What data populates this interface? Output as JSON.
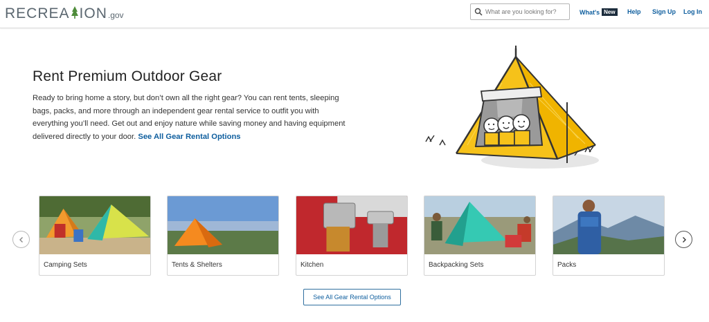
{
  "header": {
    "logo_main": "RECREATION",
    "logo_suffix": ".gov",
    "search_placeholder": "What are you looking for?",
    "nav": {
      "whats": "What's",
      "new_badge": "New",
      "help": "Help",
      "signup": "Sign Up",
      "login": "Log In"
    }
  },
  "hero": {
    "title": "Rent Premium Outdoor Gear",
    "body": "Ready to bring home a story, but don’t own all the right gear? You can rent tents, sleeping bags, packs, and more through an independent gear rental service to outfit you with everything you’ll need. Get out and enjoy nature while saving money and having equipment delivered directly to your door.",
    "link": "See All Gear Rental Options",
    "illustration_icon": "tent-illustration"
  },
  "carousel": {
    "prev_icon": "chevron-left-icon",
    "next_icon": "chevron-right-icon",
    "cards": [
      {
        "label": "Camping Sets"
      },
      {
        "label": "Tents & Shelters"
      },
      {
        "label": "Kitchen"
      },
      {
        "label": "Backpacking Sets"
      },
      {
        "label": "Packs"
      }
    ]
  },
  "cta": {
    "label": "See All Gear Rental Options"
  },
  "colors": {
    "link": "#0e5e9e",
    "badge_bg": "#1c2c3c",
    "tent_yellow": "#f5c518"
  }
}
